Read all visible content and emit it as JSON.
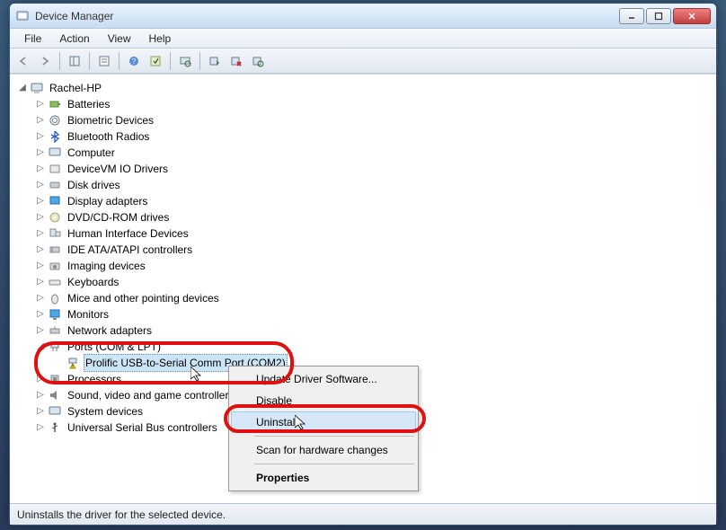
{
  "window": {
    "title": "Device Manager"
  },
  "menubar": {
    "file": "File",
    "action": "Action",
    "view": "View",
    "help": "Help"
  },
  "tree": {
    "root": "Rachel-HP",
    "items": {
      "batteries": "Batteries",
      "biometric": "Biometric Devices",
      "bluetooth": "Bluetooth Radios",
      "computer": "Computer",
      "devicevm": "DeviceVM IO Drivers",
      "disk": "Disk drives",
      "display": "Display adapters",
      "dvd": "DVD/CD-ROM drives",
      "hid": "Human Interface Devices",
      "ide": "IDE ATA/ATAPI controllers",
      "imaging": "Imaging devices",
      "keyboards": "Keyboards",
      "mice": "Mice and other pointing devices",
      "monitors": "Monitors",
      "network": "Network adapters",
      "ports": "Ports (COM & LPT)",
      "ports_child": "Prolific USB-to-Serial Comm Port (COM2)",
      "processors": "Processors",
      "sound": "Sound, video and game controllers",
      "system": "System devices",
      "usb": "Universal Serial Bus controllers"
    }
  },
  "context_menu": {
    "update": "Update Driver Software...",
    "disable": "Disable",
    "uninstall": "Uninstall",
    "scan": "Scan for hardware changes",
    "properties": "Properties"
  },
  "statusbar": {
    "text": "Uninstalls the driver for the selected device."
  }
}
